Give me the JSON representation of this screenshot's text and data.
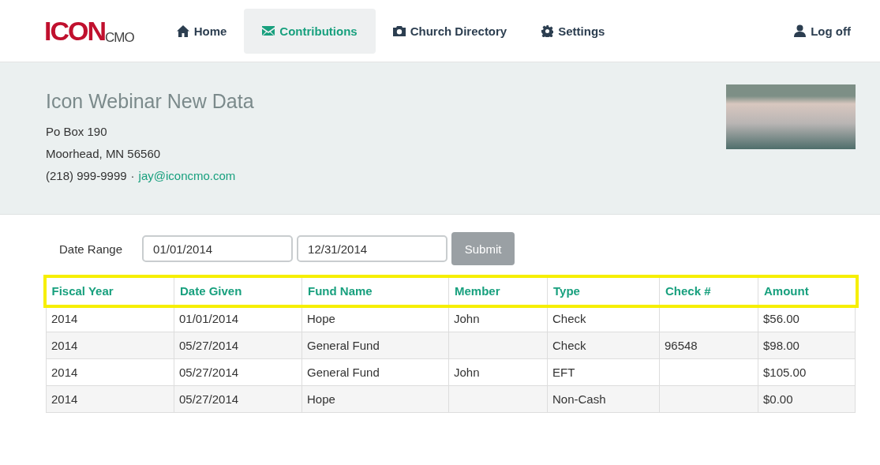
{
  "logo": {
    "main": "ICON",
    "sub": "CMO"
  },
  "nav": [
    {
      "label": "Home",
      "kind": "home",
      "selected": false
    },
    {
      "label": "Contributions",
      "kind": "mail",
      "selected": true
    },
    {
      "label": "Church Directory",
      "kind": "directory",
      "selected": false
    },
    {
      "label": "Settings",
      "kind": "settings",
      "selected": false
    }
  ],
  "logoff": {
    "label": "Log off"
  },
  "org": {
    "name": "Icon Webinar New Data",
    "address": "Po Box 190",
    "city": "Moorhead, MN 56560",
    "phone": "(218) 999-9999",
    "separator": "·",
    "email": "jay@iconcmo.com"
  },
  "filter": {
    "label": "Date Range",
    "from": "01/01/2014",
    "to": "12/31/2014",
    "submit": "Submit",
    "submit_disabled": true
  },
  "table": {
    "highlighted": true,
    "columns": [
      "Fiscal Year",
      "Date Given",
      "Fund Name",
      "Member",
      "Type",
      "Check #",
      "Amount"
    ],
    "rows": [
      [
        "2014",
        "01/01/2014",
        "Hope",
        "John",
        "Check",
        "",
        "$56.00"
      ],
      [
        "2014",
        "05/27/2014",
        "General Fund",
        "",
        "Check",
        "96548",
        "$98.00"
      ],
      [
        "2014",
        "05/27/2014",
        "General Fund",
        "John",
        "EFT",
        "",
        "$105.00"
      ],
      [
        "2014",
        "05/27/2014",
        "Hope",
        "",
        "Non-Cash",
        "",
        "$0.00"
      ]
    ]
  }
}
